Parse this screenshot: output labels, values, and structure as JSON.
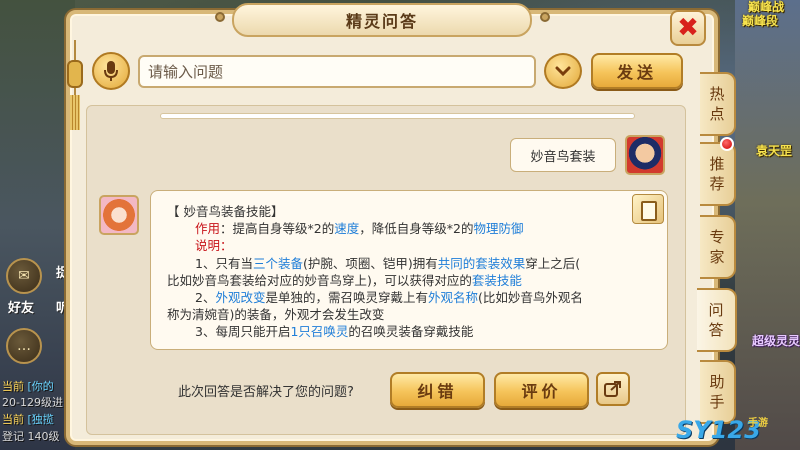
{
  "window": {
    "title": "精灵问答",
    "close_icon": "close-icon",
    "close_glyph": "✖"
  },
  "input_row": {
    "mic_icon": "microphone-icon",
    "question_placeholder": "请输入问题",
    "question_value": "",
    "dropdown_icon": "chevron-down-icon",
    "send_label": "发送"
  },
  "conversation": {
    "user_message": "妙音鸟套装",
    "answer": {
      "title": "【 妙音鸟装备技能】",
      "effect_label": "作用",
      "effect_segments": [
        "：提高自身等级*2的",
        "速度",
        "，降低自身等级*2的",
        "物理防御"
      ],
      "note_label": "说明",
      "note_colon": "：",
      "item1_segments": [
        "1、只有当",
        "三个装备",
        "(护腕、项圈、铠甲)拥有",
        "共同的套装效果",
        "穿上之后("
      ],
      "item1_cont_segments": [
        "比如妙音鸟套装给对应的妙音鸟穿上)，可以获得对应的",
        "套装技能"
      ],
      "item2_segments": [
        "2、",
        "外观改变",
        "是单独的，需召唤灵穿戴上有",
        "外观名称",
        "(比如妙音鸟外观名"
      ],
      "item2_cont1": "称为清婉音)的装备，外观才会发生改变",
      "item3_segments": [
        "3、每周只能开启",
        "1只召唤灵",
        "的召唤灵装备穿戴技能"
      ]
    }
  },
  "feedback": {
    "question": "此次回答是否解决了您的问题?",
    "correct_label": "纠错",
    "rate_label": "评价",
    "share_icon": "share-icon"
  },
  "side_tabs": [
    {
      "label_top": "热",
      "label_bottom": "点"
    },
    {
      "label_top": "推",
      "label_bottom": "荐"
    },
    {
      "label_top": "专",
      "label_bottom": "家"
    },
    {
      "label_top": "问",
      "label_bottom": "答"
    },
    {
      "label_top": "助",
      "label_bottom": "手"
    }
  ],
  "background": {
    "npc_labels": [
      "巅峰战",
      "巅峰段",
      "袁天罡",
      "超级灵灵"
    ],
    "left_labels": [
      "好友",
      "捉",
      "听"
    ],
    "chat_lines": [
      {
        "channel": "当前",
        "text": "[你的"
      },
      {
        "channel": "",
        "text": "20-129级进"
      },
      {
        "channel": "当前",
        "text": "[独揽"
      },
      {
        "channel": "",
        "text": "登记 140级"
      }
    ],
    "watermark": "SY123",
    "watermark_sub": "手游"
  },
  "colors": {
    "accent_red": "#c8141a",
    "accent_blue": "#1f7ed8",
    "gold_button": "#f5c45a",
    "panel_bg": "#f4ecda"
  }
}
